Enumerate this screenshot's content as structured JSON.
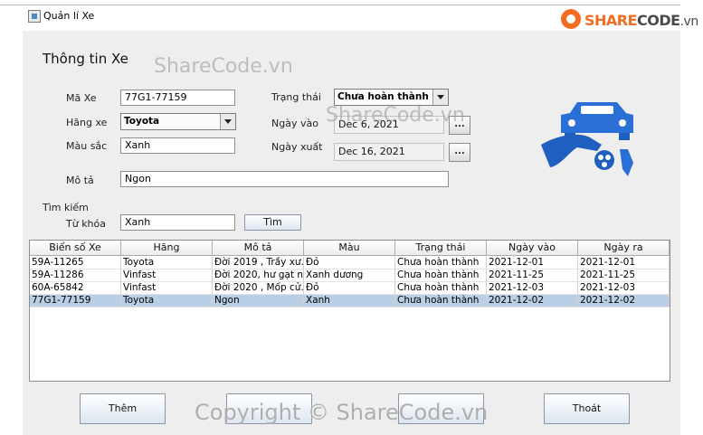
{
  "window": {
    "title": "Quản lí Xe"
  },
  "brand": {
    "logo_part1": "SHARE",
    "logo_part2": "CODE",
    "logo_part3": ".vn"
  },
  "form": {
    "heading": "Thông tin Xe",
    "ma_xe_label": "Mã Xe",
    "ma_xe_value": "77G1-77159",
    "hang_xe_label": "Hãng xe",
    "hang_xe_value": "Toyota",
    "mau_sac_label": "Màu sắc",
    "mau_sac_value": "Xanh",
    "mo_ta_label": "Mô tả",
    "mo_ta_value": "Ngon",
    "trang_thai_label": "Trạng thái",
    "trang_thai_value": "Chưa hoàn thành",
    "ngay_vao_label": "Ngày vào",
    "ngay_vao_value": "Dec 6, 2021",
    "ngay_xuat_label": "Ngày xuất",
    "ngay_xuat_value": "Dec 16, 2021",
    "date_button_label": "..."
  },
  "search": {
    "section_label": "Tìm kiếm",
    "keyword_label": "Từ khóa",
    "keyword_value": "Xanh",
    "button_label": "Tìm"
  },
  "table": {
    "columns": [
      "Biển số Xe",
      "Hãng",
      "Mô tả",
      "Màu",
      "Trạng thái",
      "Ngày vào",
      "Ngày ra"
    ],
    "rows": [
      [
        "59A-11265",
        "Toyota",
        "Đời 2019 , Trầy xư...",
        "Đỏ",
        "Chưa hoàn thành",
        "2021-12-01",
        "2021-12-01"
      ],
      [
        "59A-11286",
        "Vinfast",
        "Đời 2020, hư gạt n...",
        "Xanh dương",
        "Chưa hoàn thành",
        "2021-11-25",
        "2021-11-25"
      ],
      [
        "60A-65842",
        "Vinfast",
        "Đời 2020 , Mốp cử...",
        "Đỏ",
        "Chưa hoàn thành",
        "2021-12-03",
        "2021-12-03"
      ],
      [
        "77G1-77159",
        "Toyota",
        "Ngon",
        "Xanh",
        "Chưa hoàn thành",
        "2021-12-02",
        "2021-12-02"
      ]
    ],
    "selected_row": 3
  },
  "buttons": {
    "add": "Thêm",
    "exit": "Thoát"
  },
  "watermarks": {
    "top": "ShareCode.vn",
    "middle": "ShareCode.vn",
    "bottom": "Copyright © ShareCode.vn"
  },
  "colors": {
    "accent_blue": "#1f5fbf",
    "brand_orange": "#f26c22",
    "selection": "#b8cfe5"
  },
  "icons": [
    "app-window-icon",
    "sharecode-logo-icon",
    "car-service-hand-icon",
    "dropdown-arrow-icon"
  ]
}
